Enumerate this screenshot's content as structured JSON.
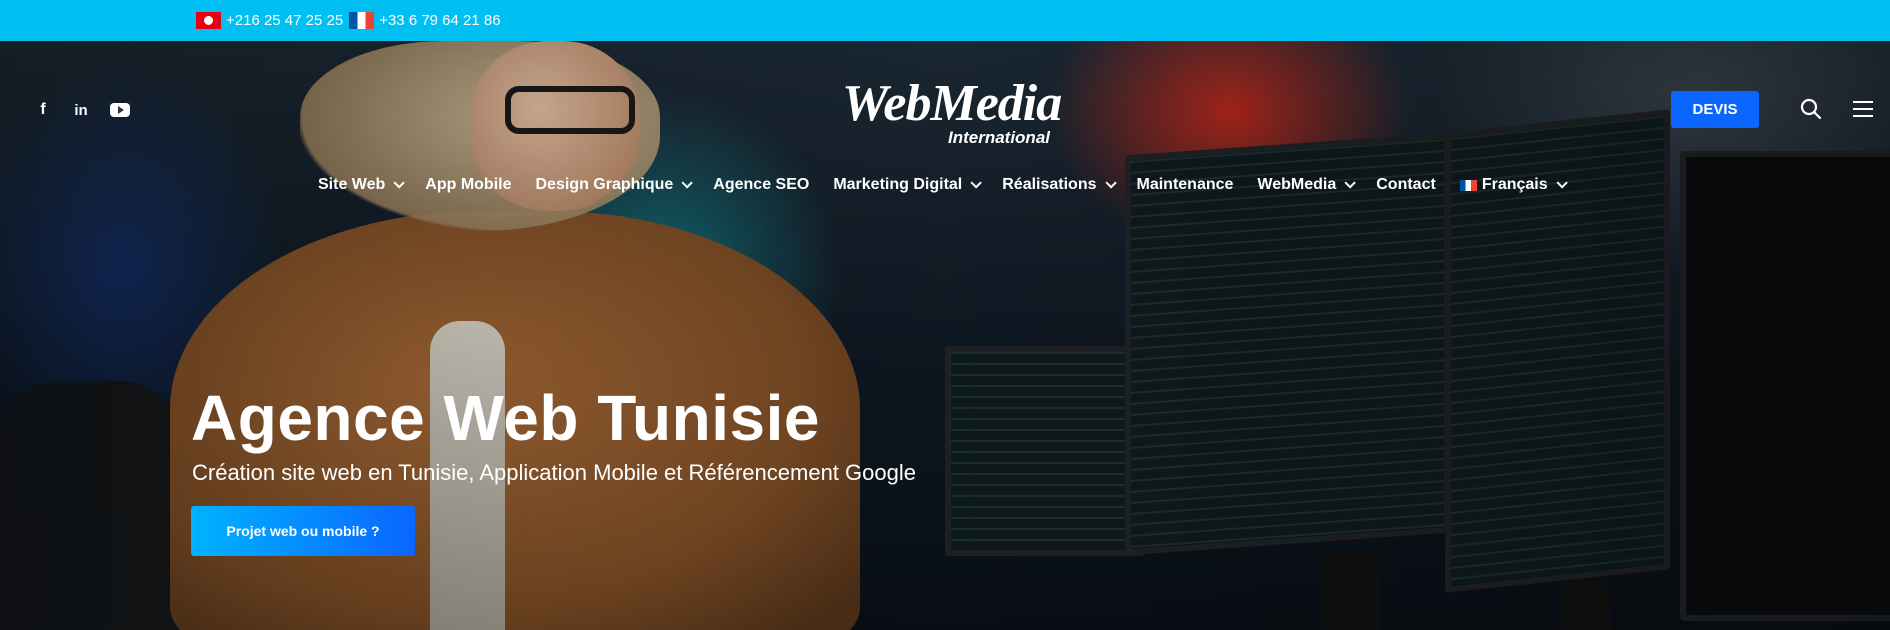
{
  "topbar": {
    "phone_tn": "+216 25 47 25 25",
    "phone_fr": "+33 6 79 64 21 86"
  },
  "header": {
    "logo_main": "WebMedia",
    "logo_sub": "International",
    "devis_label": "DEVIS",
    "social_icons": [
      "facebook-icon",
      "linkedin-icon",
      "youtube-icon"
    ]
  },
  "nav": {
    "items": [
      {
        "label": "Site Web",
        "dropdown": true
      },
      {
        "label": "App Mobile",
        "dropdown": false
      },
      {
        "label": "Design Graphique",
        "dropdown": true
      },
      {
        "label": "Agence SEO",
        "dropdown": false
      },
      {
        "label": "Marketing Digital",
        "dropdown": true
      },
      {
        "label": "Réalisations",
        "dropdown": true
      },
      {
        "label": "Maintenance",
        "dropdown": false
      },
      {
        "label": "WebMedia",
        "dropdown": true
      },
      {
        "label": "Contact",
        "dropdown": false
      },
      {
        "label": "Français",
        "dropdown": true
      }
    ]
  },
  "hero": {
    "title": "Agence Web Tunisie",
    "subtitle": "Création site web en Tunisie, Application Mobile et Référencement Google",
    "cta_label": "Projet web ou mobile ?"
  },
  "colors": {
    "topbar": "#00c0f2",
    "accent": "#0a66ff",
    "cta_gradient_start": "#00b3ff"
  }
}
